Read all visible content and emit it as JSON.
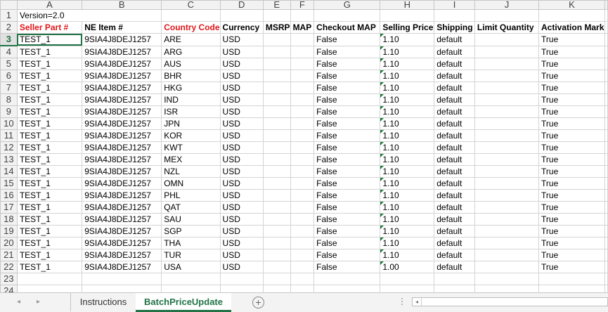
{
  "spreadsheet": {
    "column_letters": [
      "A",
      "B",
      "C",
      "D",
      "E",
      "F",
      "G",
      "H",
      "I",
      "J",
      "K"
    ],
    "row_numbers": [
      "1",
      "2",
      "3",
      "4",
      "5",
      "6",
      "7",
      "8",
      "9",
      "10",
      "11",
      "12",
      "13",
      "14",
      "15",
      "16",
      "17",
      "18",
      "19",
      "20",
      "21",
      "22",
      "23",
      "24"
    ],
    "version_text": "Version=2.0",
    "headers": [
      "Seller Part #",
      "NE Item #",
      "Country Code",
      "Currency",
      "MSRP",
      "MAP",
      "Checkout MAP",
      "Selling Price",
      "Shipping",
      "Limit Quantity",
      "Activation Mark"
    ],
    "rows": [
      [
        "TEST_1",
        "9SIA4J8DEJ1257",
        "ARE",
        "USD",
        "",
        "",
        "False",
        "1.10",
        "default",
        "",
        "True"
      ],
      [
        "TEST_1",
        "9SIA4J8DEJ1257",
        "ARG",
        "USD",
        "",
        "",
        "False",
        "1.10",
        "default",
        "",
        "True"
      ],
      [
        "TEST_1",
        "9SIA4J8DEJ1257",
        "AUS",
        "USD",
        "",
        "",
        "False",
        "1.10",
        "default",
        "",
        "True"
      ],
      [
        "TEST_1",
        "9SIA4J8DEJ1257",
        "BHR",
        "USD",
        "",
        "",
        "False",
        "1.10",
        "default",
        "",
        "True"
      ],
      [
        "TEST_1",
        "9SIA4J8DEJ1257",
        "HKG",
        "USD",
        "",
        "",
        "False",
        "1.10",
        "default",
        "",
        "True"
      ],
      [
        "TEST_1",
        "9SIA4J8DEJ1257",
        "IND",
        "USD",
        "",
        "",
        "False",
        "1.10",
        "default",
        "",
        "True"
      ],
      [
        "TEST_1",
        "9SIA4J8DEJ1257",
        "ISR",
        "USD",
        "",
        "",
        "False",
        "1.10",
        "default",
        "",
        "True"
      ],
      [
        "TEST_1",
        "9SIA4J8DEJ1257",
        "JPN",
        "USD",
        "",
        "",
        "False",
        "1.10",
        "default",
        "",
        "True"
      ],
      [
        "TEST_1",
        "9SIA4J8DEJ1257",
        "KOR",
        "USD",
        "",
        "",
        "False",
        "1.10",
        "default",
        "",
        "True"
      ],
      [
        "TEST_1",
        "9SIA4J8DEJ1257",
        "KWT",
        "USD",
        "",
        "",
        "False",
        "1.10",
        "default",
        "",
        "True"
      ],
      [
        "TEST_1",
        "9SIA4J8DEJ1257",
        "MEX",
        "USD",
        "",
        "",
        "False",
        "1.10",
        "default",
        "",
        "True"
      ],
      [
        "TEST_1",
        "9SIA4J8DEJ1257",
        "NZL",
        "USD",
        "",
        "",
        "False",
        "1.10",
        "default",
        "",
        "True"
      ],
      [
        "TEST_1",
        "9SIA4J8DEJ1257",
        "OMN",
        "USD",
        "",
        "",
        "False",
        "1.10",
        "default",
        "",
        "True"
      ],
      [
        "TEST_1",
        "9SIA4J8DEJ1257",
        "PHL",
        "USD",
        "",
        "",
        "False",
        "1.10",
        "default",
        "",
        "True"
      ],
      [
        "TEST_1",
        "9SIA4J8DEJ1257",
        "QAT",
        "USD",
        "",
        "",
        "False",
        "1.10",
        "default",
        "",
        "True"
      ],
      [
        "TEST_1",
        "9SIA4J8DEJ1257",
        "SAU",
        "USD",
        "",
        "",
        "False",
        "1.10",
        "default",
        "",
        "True"
      ],
      [
        "TEST_1",
        "9SIA4J8DEJ1257",
        "SGP",
        "USD",
        "",
        "",
        "False",
        "1.10",
        "default",
        "",
        "True"
      ],
      [
        "TEST_1",
        "9SIA4J8DEJ1257",
        "THA",
        "USD",
        "",
        "",
        "False",
        "1.10",
        "default",
        "",
        "True"
      ],
      [
        "TEST_1",
        "9SIA4J8DEJ1257",
        "TUR",
        "USD",
        "",
        "",
        "False",
        "1.10",
        "default",
        "",
        "True"
      ],
      [
        "TEST_1",
        "9SIA4J8DEJ1257",
        "USA",
        "USD",
        "",
        "",
        "False",
        "1.00",
        "default",
        "",
        "True"
      ]
    ],
    "red_header_columns": [
      0,
      2
    ],
    "number_as_text_column": 7,
    "active_row": "3",
    "colors": {
      "accent": "#217346",
      "red_header": "#e0161b",
      "text_number_marker": "#1e7c3a"
    }
  },
  "tabs": {
    "sheets": [
      "Instructions",
      "BatchPriceUpdate"
    ],
    "active": "BatchPriceUpdate",
    "add_icon": "plus-circle-icon",
    "prev_icon": "◂",
    "next_icon": "▸",
    "options_icon": "⋮",
    "scroll_left_icon": "◂"
  }
}
